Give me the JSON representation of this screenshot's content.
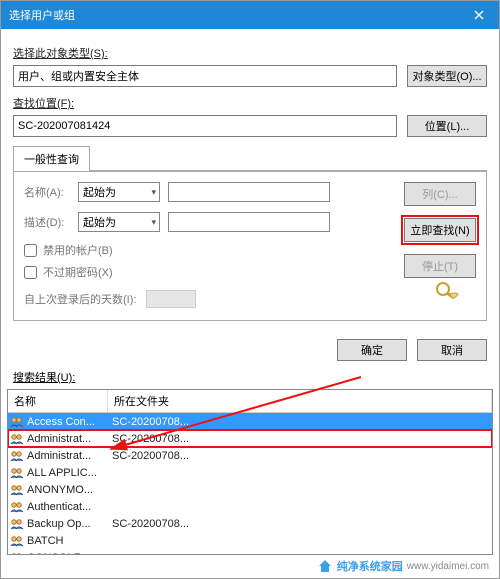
{
  "window": {
    "title": "选择用户或组"
  },
  "section1": {
    "objtype_label": "选择此对象类型(S):",
    "objtype_value": "用户、组或内置安全主体",
    "objtype_btn": "对象类型(O)...",
    "location_label": "查找位置(F):",
    "location_value": "SC-202007081424",
    "location_btn": "位置(L)..."
  },
  "tab": {
    "label": "一般性查询"
  },
  "query": {
    "name_label": "名称(A):",
    "name_mode": "起始为",
    "desc_label": "描述(D):",
    "desc_mode": "起始为",
    "cb_disabled": "禁用的帐户(B)",
    "cb_pwnever": "不过期密码(X)",
    "days_label": "自上次登录后的天数(I):"
  },
  "rightbtns": {
    "columns": "列(C)...",
    "findnow": "立即查找(N)",
    "stop": "停止(T)"
  },
  "okrow": {
    "ok": "确定",
    "cancel": "取消"
  },
  "results": {
    "label": "搜索结果(U):",
    "col1": "名称",
    "col2": "所在文件夹",
    "rows": [
      {
        "name": "Access Con...",
        "folder": "SC-20200708...",
        "selstyle": "first"
      },
      {
        "name": "Administrat...",
        "folder": "SC-20200708...",
        "selstyle": "highlight"
      },
      {
        "name": "Administrat...",
        "folder": "SC-20200708...",
        "selstyle": ""
      },
      {
        "name": "ALL APPLIC...",
        "folder": "",
        "selstyle": ""
      },
      {
        "name": "ANONYMO...",
        "folder": "",
        "selstyle": ""
      },
      {
        "name": "Authenticat...",
        "folder": "",
        "selstyle": ""
      },
      {
        "name": "Backup Op...",
        "folder": "SC-20200708...",
        "selstyle": ""
      },
      {
        "name": "BATCH",
        "folder": "",
        "selstyle": ""
      },
      {
        "name": "CONSOLE ...",
        "folder": "",
        "selstyle": ""
      }
    ]
  },
  "watermark": {
    "text": "纯净系统家园",
    "url": "www.yidaimei.com"
  }
}
